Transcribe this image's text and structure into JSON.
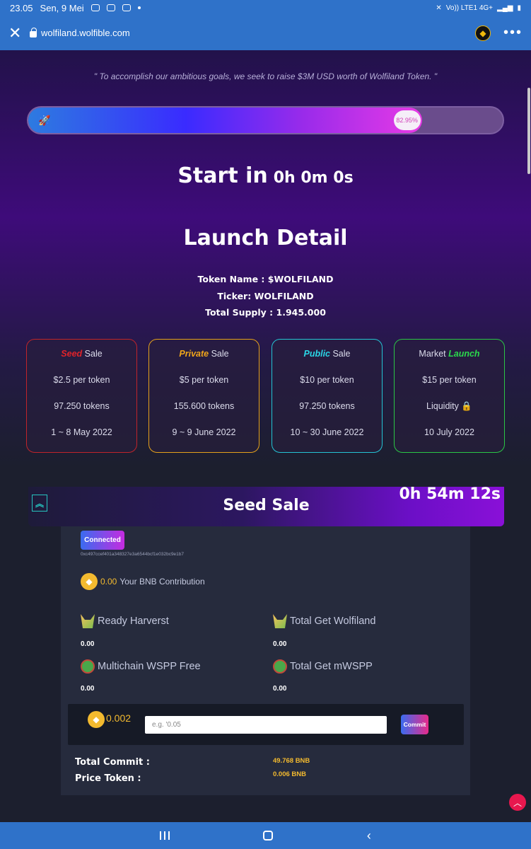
{
  "status": {
    "time": "23.05",
    "date": "Sen, 9 Mei",
    "network": "Vo)) LTE1 4G+"
  },
  "browser": {
    "url": "wolfiland.wolfible.com"
  },
  "hero": {
    "quote": "\" To accomplish our ambitious goals, we seek to raise $3M USD worth of Wolfiland Token. \"",
    "progress_percent": 82.95,
    "progress_label": "82.95%",
    "start_label": "Start in",
    "countdown": "0h 0m 0s"
  },
  "launch": {
    "title": "Launch Detail",
    "token_name": "Token Name : $WOLFILAND",
    "ticker": "Ticker: WOLFILAND",
    "supply": "Total Supply : 1.945.000"
  },
  "cards": [
    {
      "highlight": "Seed",
      "rest": " Sale",
      "price": "$2.5 per token",
      "amount": "97.250 tokens",
      "date": "1 ~ 8 May 2022",
      "color": "#e0232a"
    },
    {
      "highlight": "Private",
      "rest": " Sale",
      "price": "$5 per token",
      "amount": "155.600 tokens",
      "date": "9 ~ 9 June 2022",
      "color": "#f0a51b"
    },
    {
      "highlight": "Public",
      "rest": " Sale",
      "price": "$10 per token",
      "amount": "97.250 tokens",
      "date": "10 ~ 30 June 2022",
      "color": "#2ad6e6"
    },
    {
      "prefix": "Market ",
      "highlight": "Launch",
      "price": "$15 per token",
      "amount": "Liquidity 🔒",
      "date": "10 July 2022",
      "color": "#2bd94c"
    }
  ],
  "seed": {
    "title": "Seed Sale",
    "timer": "0h 54m 12s",
    "connected_label": "Connected",
    "address": "0xc497ccef401a348327e3a6544bcf1e032bc9e1b7",
    "contribution_amount": "0.00",
    "contribution_label": "Your BNB Contribution",
    "stats": [
      {
        "label": "Ready Harverst",
        "value": "0.00"
      },
      {
        "label": "Total Get Wolfiland",
        "value": "0.00"
      },
      {
        "label": "Multichain WSPP Free",
        "value": "0.00"
      },
      {
        "label": "Total Get mWSPP",
        "value": "0.00"
      }
    ],
    "bnb_value": "0.002",
    "input_placeholder": "e.g. '0.05",
    "commit_label": "Commit",
    "total_commit_label": "Total Commit :",
    "total_commit_value": "49.768 BNB",
    "price_token_label": "Price Token :",
    "price_token_value": "0.006 BNB"
  }
}
